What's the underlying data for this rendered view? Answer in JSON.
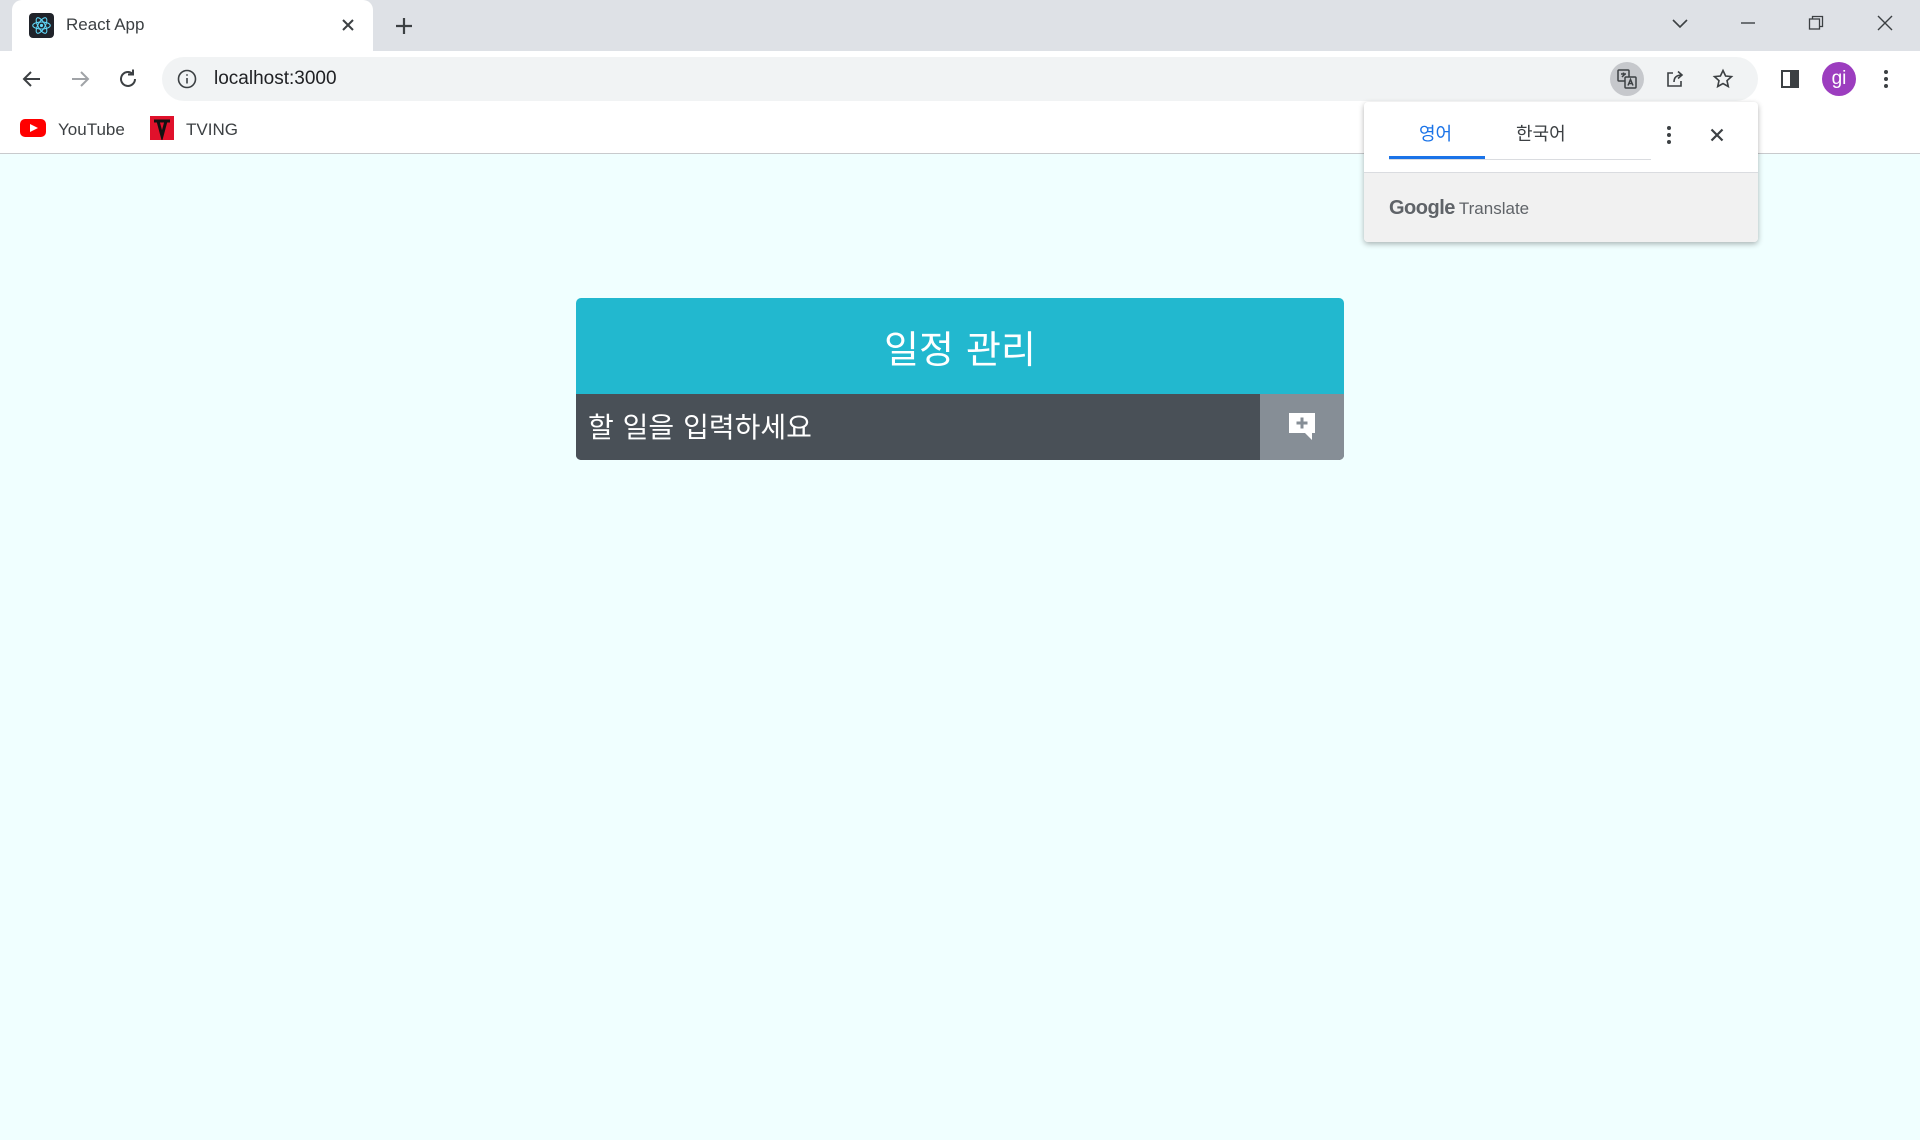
{
  "browser": {
    "tab": {
      "title": "React App",
      "favicon": "react-logo-icon"
    },
    "address": {
      "url": "localhost:3000"
    },
    "avatar_initials": "gi",
    "bookmarks": [
      {
        "label": "YouTube",
        "icon": "youtube-icon"
      },
      {
        "label": "TVING",
        "icon": "tving-icon"
      }
    ]
  },
  "translate_popup": {
    "tabs": [
      {
        "label": "영어",
        "active": true
      },
      {
        "label": "한국어",
        "active": false
      }
    ],
    "brand_google": "Google",
    "brand_translate": "Translate"
  },
  "app": {
    "title": "일정 관리",
    "input": {
      "placeholder": "할 일을 입력하세요",
      "value": ""
    },
    "submit_icon": "add-comment-icon"
  },
  "colors": {
    "page_bg": "#f0ffff",
    "header_bg": "#22b8cf",
    "input_bg": "#495057",
    "button_bg": "#868e96",
    "accent": "#1a73e8"
  }
}
